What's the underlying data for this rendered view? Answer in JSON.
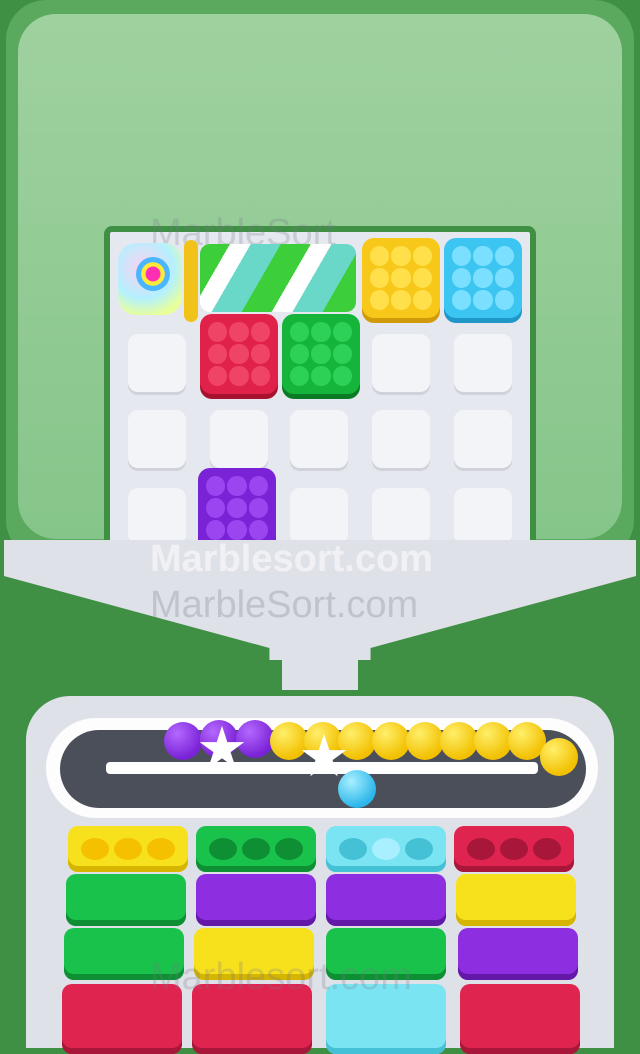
{
  "watermarks": {
    "bold": "Marblesort.com",
    "regular": "MarbleSort.com",
    "faint_top": "MarbleSort",
    "faint_bottom": "Marblesort.com"
  },
  "colors": {
    "yellow": "#f7c81a",
    "blue": "#3cc5f0",
    "red": "#e0224a",
    "green": "#14b53a",
    "purple": "#7a22d6",
    "cyan": "#7be4f2",
    "background_green": "#4a9d4e"
  },
  "board": {
    "boxes": [
      "yellow",
      "blue",
      "red",
      "green",
      "purple"
    ],
    "special_items": [
      "rainbow-roller",
      "striped-bar"
    ]
  },
  "conveyor": {
    "marbles": [
      "purple",
      "purple",
      "purple",
      "yellow",
      "yellow",
      "yellow",
      "yellow",
      "yellow",
      "yellow",
      "yellow",
      "yellow",
      "yellow"
    ],
    "loose_marble": "blue",
    "effects": [
      "star",
      "star"
    ]
  },
  "columns": [
    {
      "top": "yellow",
      "top_filled": 3,
      "stack": [
        "green",
        "green",
        "red"
      ]
    },
    {
      "top": "green",
      "top_filled": 0,
      "stack": [
        "purple",
        "yellow",
        "red"
      ]
    },
    {
      "top": "cyan",
      "top_filled": 1,
      "stack": [
        "purple",
        "green",
        "cyan"
      ]
    },
    {
      "top": "red",
      "top_filled": 0,
      "stack": [
        "yellow",
        "purple",
        "red"
      ]
    }
  ]
}
